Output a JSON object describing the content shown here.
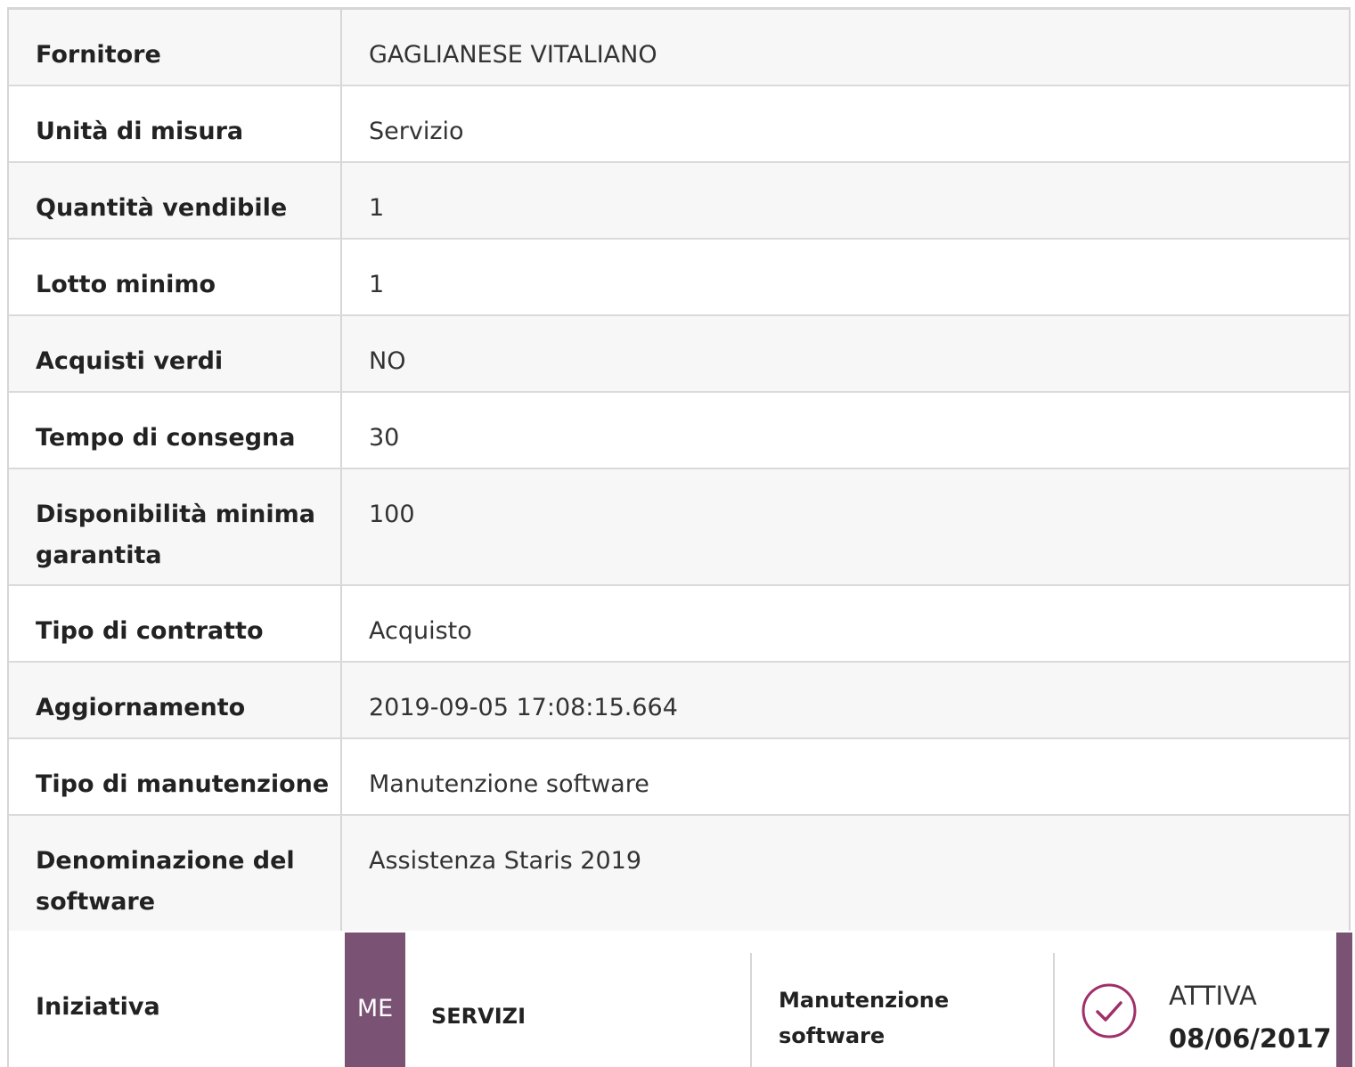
{
  "rows": [
    {
      "label": "Fornitore",
      "value": "GAGLIANESE VITALIANO"
    },
    {
      "label": "Unità di misura",
      "value": "Servizio"
    },
    {
      "label": "Quantità vendibile",
      "value": "1"
    },
    {
      "label": "Lotto minimo",
      "value": "1"
    },
    {
      "label": "Acquisti verdi",
      "value": "NO"
    },
    {
      "label": "Tempo di consegna",
      "value": "30"
    },
    {
      "label": "Disponibilità minima garantita",
      "value": "100"
    },
    {
      "label": "Tipo di contratto",
      "value": "Acquisto"
    },
    {
      "label": "Aggiornamento",
      "value": "2019-09-05 17:08:15.664"
    },
    {
      "label": "Tipo di manutenzione",
      "value": "Manutenzione software"
    },
    {
      "label": "Denominazione del software",
      "value": "Assistenza Staris 2019"
    }
  ],
  "initiative": {
    "label": "Iniziativa",
    "badge": "ME",
    "category": "SERVIZI",
    "name": "Manutenzione software",
    "status": "ATTIVA",
    "date": "08/06/2017",
    "status_icon": "check-circle-icon",
    "accent_color": "#7a5374"
  }
}
